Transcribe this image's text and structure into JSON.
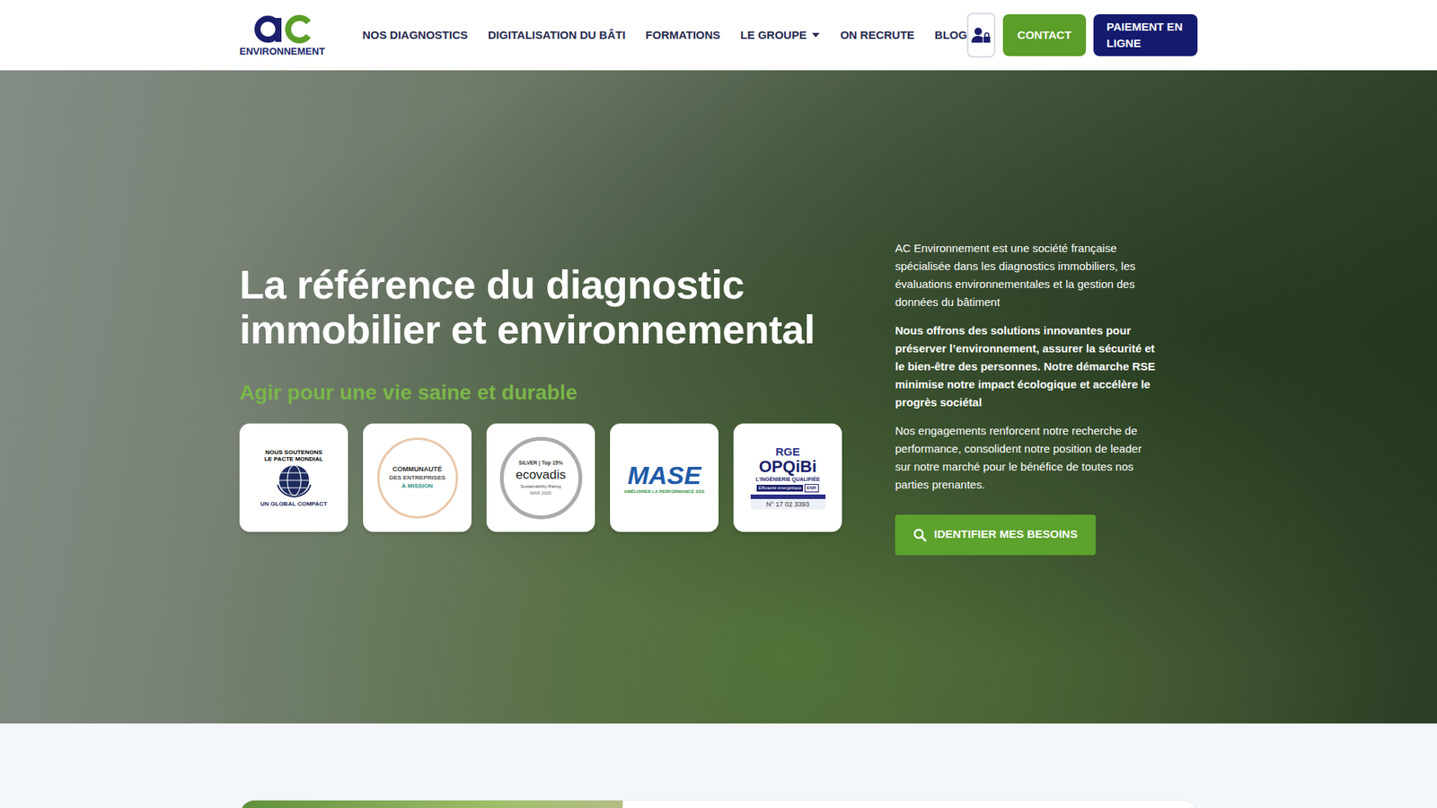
{
  "logo": {
    "text": "ENVIRONNEMENT"
  },
  "nav": [
    {
      "label": "NOS DIAGNOSTICS",
      "has_dropdown": false
    },
    {
      "label": "DIGITALISATION DU BÂTI",
      "has_dropdown": false
    },
    {
      "label": "FORMATIONS",
      "has_dropdown": false
    },
    {
      "label": "LE GROUPE",
      "has_dropdown": true
    },
    {
      "label": "ON RECRUTE",
      "has_dropdown": false
    },
    {
      "label": "BLOG",
      "has_dropdown": false
    }
  ],
  "header": {
    "contact": "CONTACT",
    "payment": "PAIEMENT EN LIGNE"
  },
  "hero": {
    "title_lines": [
      "La référence du diagnostic",
      "immobilier et environnemental"
    ],
    "subtitle": "Agir pour une vie saine et durable",
    "paragraphs": [
      {
        "text": "AC Environnement est une société française spécialisée dans les diagnostics immobiliers, les évaluations environnementales et la gestion des données du bâtiment",
        "bold": false
      },
      {
        "text": "Nous offrons des solutions innovantes pour préserver l’environnement, assurer la sécurité et le bien-être des personnes. Notre démarche RSE minimise notre impact écologique et accélère le progrès sociétal",
        "bold": true
      },
      {
        "text": "Nos engagements renforcent notre recherche de performance, consolident notre position de leader sur notre marché pour le bénéfice de toutes nos parties prenantes.",
        "bold": false
      }
    ],
    "cta": "IDENTIFIER MES BESOINS"
  },
  "certifications": [
    {
      "kind": "globalcompact",
      "lines": [
        "NOUS SOUTENONS",
        "LE PACTE MONDIAL",
        "UN GLOBAL COMPACT"
      ]
    },
    {
      "kind": "mission",
      "lines": [
        "COMMUNAUTÉ",
        "DES ENTREPRISES",
        "À MISSION"
      ]
    },
    {
      "kind": "ecovadis",
      "lines": [
        "SILVER | Top 15%",
        "ecovadis",
        "Sustainability Rating",
        "MAR 2025"
      ]
    },
    {
      "kind": "mase",
      "lines": [
        "MASE",
        "AMÉLIORER LA PERFORMANCE SSE"
      ]
    },
    {
      "kind": "opqibi",
      "lines": [
        "RGE",
        "OPQiBi",
        "L'INGÉNIERIE QUALIFIÉE",
        "Efficacité énergétique",
        "ENR",
        "N° 17 02 3393"
      ]
    }
  ]
}
